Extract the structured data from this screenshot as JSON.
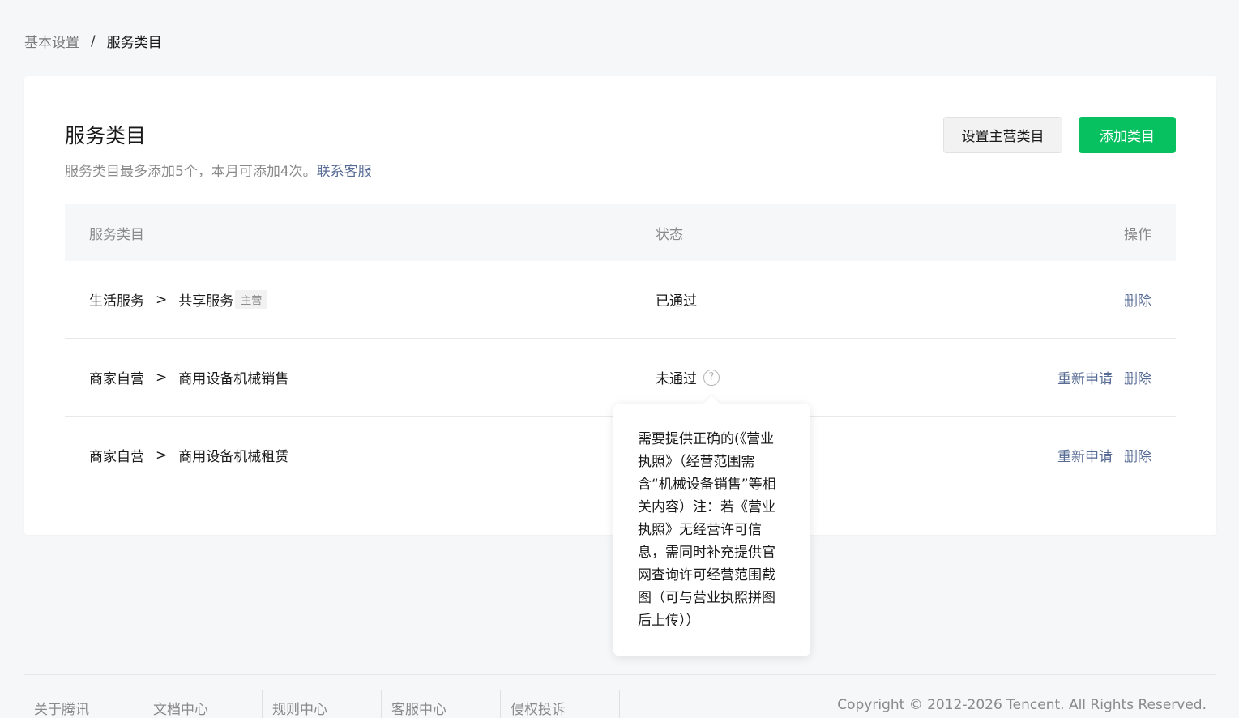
{
  "breadcrumb": {
    "parent": "基本设置",
    "separator": "/",
    "current": "服务类目"
  },
  "card": {
    "title": "服务类目",
    "desc": "服务类目最多添加5个，本月可添加4次。",
    "desc_link": "联系客服",
    "btn_set_main": "设置主营类目",
    "btn_add": "添加类目"
  },
  "table": {
    "headers": {
      "category": "服务类目",
      "status": "状态",
      "action": "操作"
    },
    "rows": [
      {
        "level1": "生活服务",
        "arrow": ">",
        "level2": "共享服务",
        "tag": "主营",
        "status": "已通过",
        "reapply": "",
        "delete": "删除"
      },
      {
        "level1": "商家自营",
        "arrow": ">",
        "level2": "商用设备机械销售",
        "tag": "",
        "status": "未通过",
        "reapply": "重新申请",
        "delete": "删除"
      },
      {
        "level1": "商家自营",
        "arrow": ">",
        "level2": "商用设备机械租赁",
        "tag": "",
        "status": "",
        "reapply": "重新申请",
        "delete": "删除"
      }
    ]
  },
  "tooltip": {
    "text": "需要提供正确的(《营业执照》（经营范围需含“机械设备销售”等相关内容）注：若《营业执照》无经营许可信息，需同时补充提供官网查询许可经营范围截图（可与营业执照拼图后上传））"
  },
  "footer": {
    "links": [
      "关于腾讯",
      "文档中心",
      "规则中心",
      "客服中心",
      "侵权投诉"
    ],
    "copyright": "Copyright © 2012-2026 Tencent. All Rights Reserved."
  },
  "colors": {
    "primary": "#07c160",
    "link": "#576b95",
    "muted": "#8a8a8a"
  },
  "icons": {
    "help": "question-circle-icon"
  }
}
